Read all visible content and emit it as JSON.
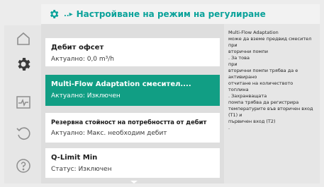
{
  "header": {
    "breadcrumb": "..▸",
    "title": "Настройване на режим на регулиране"
  },
  "rail": {
    "items": [
      {
        "name": "home",
        "icon": "home-icon"
      },
      {
        "name": "settings",
        "icon": "gear-icon",
        "active": true
      },
      {
        "name": "diagnostics",
        "icon": "pulse-icon"
      },
      {
        "name": "restore",
        "icon": "restore-icon"
      },
      {
        "name": "help",
        "icon": "help-icon"
      }
    ]
  },
  "menu": {
    "items": [
      {
        "title": "Дебит офсет",
        "subtitle": "Актуално: 0,0 m³/h"
      },
      {
        "title": "Multi-Flow Adaptation смесител....",
        "subtitle": "Актуално: Изключен"
      },
      {
        "title": "Резервна стойност на потребността от дебит",
        "subtitle": "Актуално: Макс. необходим дебит"
      },
      {
        "title": "Q-Limit Min",
        "subtitle": "Статус: Изключен"
      }
    ]
  },
  "help": {
    "text": "Multi-Flow Adaptation\nможе да вземе предвид смесител\nпри\nвторични помпи\n. За това\nпри\nвторични помпи трябва да е\nактивирано\nотчитане на количеството\nтоплина\n. Захранващата\nпомпа трябва да регистрира\nтемпературите във вторичен вход\n(T1) и\nпървичен вход (T2)\n."
  },
  "colors": {
    "accent": "#0aa29a",
    "selected": "#119e84"
  }
}
